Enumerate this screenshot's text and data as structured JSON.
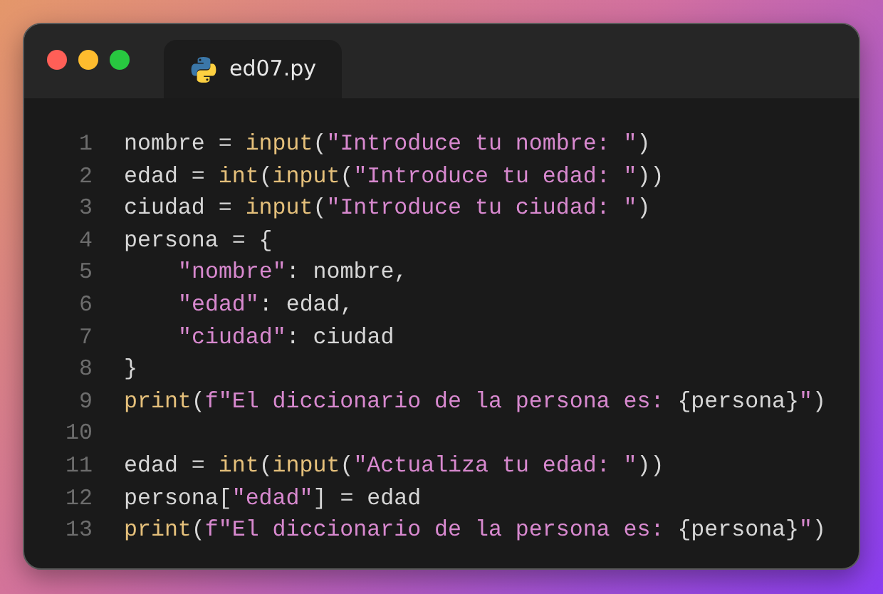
{
  "window": {
    "controls": [
      {
        "color": "#ff5f57"
      },
      {
        "color": "#febc2e"
      },
      {
        "color": "#28c840"
      }
    ]
  },
  "tabs": [
    {
      "label": "ed07.py",
      "selected": true
    }
  ],
  "code": [
    {
      "number": "1",
      "tokens": [
        {
          "kind": "plain",
          "text": "nombre = "
        },
        {
          "kind": "func",
          "text": "input"
        },
        {
          "kind": "plain",
          "text": "("
        },
        {
          "kind": "str",
          "text": "\"Introduce tu nombre: \""
        },
        {
          "kind": "plain",
          "text": ")"
        }
      ]
    },
    {
      "number": "2",
      "tokens": [
        {
          "kind": "plain",
          "text": "edad = "
        },
        {
          "kind": "func",
          "text": "int"
        },
        {
          "kind": "plain",
          "text": "("
        },
        {
          "kind": "func",
          "text": "input"
        },
        {
          "kind": "plain",
          "text": "("
        },
        {
          "kind": "str",
          "text": "\"Introduce tu edad: \""
        },
        {
          "kind": "plain",
          "text": "))"
        }
      ]
    },
    {
      "number": "3",
      "tokens": [
        {
          "kind": "plain",
          "text": "ciudad = "
        },
        {
          "kind": "func",
          "text": "input"
        },
        {
          "kind": "plain",
          "text": "("
        },
        {
          "kind": "str",
          "text": "\"Introduce tu ciudad: \""
        },
        {
          "kind": "plain",
          "text": ")"
        }
      ]
    },
    {
      "number": "4",
      "tokens": [
        {
          "kind": "plain",
          "text": "persona = {"
        }
      ],
      "children": [
        {
          "number": "5",
          "tokens": [
            {
              "kind": "str",
              "text": "\"nombre\""
            },
            {
              "kind": "plain",
              "text": ": nombre,"
            }
          ]
        },
        {
          "number": "6",
          "tokens": [
            {
              "kind": "str",
              "text": "\"edad\""
            },
            {
              "kind": "plain",
              "text": ": edad,"
            }
          ]
        },
        {
          "number": "7",
          "tokens": [
            {
              "kind": "str",
              "text": "\"ciudad\""
            },
            {
              "kind": "plain",
              "text": ": ciudad"
            }
          ]
        }
      ]
    },
    {
      "number": "8",
      "tokens": [
        {
          "kind": "plain",
          "text": "}"
        }
      ]
    },
    {
      "number": "9",
      "tokens": [
        {
          "kind": "func",
          "text": "print"
        },
        {
          "kind": "plain",
          "text": "("
        },
        {
          "kind": "str",
          "text": "f\"El diccionario de la persona es: "
        },
        {
          "kind": "plain",
          "text": "{persona}"
        },
        {
          "kind": "str",
          "text": "\""
        },
        {
          "kind": "plain",
          "text": ")"
        }
      ]
    },
    {
      "number": "10"
    },
    {
      "number": "11",
      "tokens": [
        {
          "kind": "plain",
          "text": "edad = "
        },
        {
          "kind": "func",
          "text": "int"
        },
        {
          "kind": "plain",
          "text": "("
        },
        {
          "kind": "func",
          "text": "input"
        },
        {
          "kind": "plain",
          "text": "("
        },
        {
          "kind": "str",
          "text": "\"Actualiza tu edad: \""
        },
        {
          "kind": "plain",
          "text": "))"
        }
      ]
    },
    {
      "number": "12",
      "tokens": [
        {
          "kind": "plain",
          "text": "persona["
        },
        {
          "kind": "str",
          "text": "\"edad\""
        },
        {
          "kind": "plain",
          "text": "] = edad"
        }
      ]
    },
    {
      "number": "13",
      "tokens": [
        {
          "kind": "func",
          "text": "print"
        },
        {
          "kind": "plain",
          "text": "("
        },
        {
          "kind": "str",
          "text": "f\"El diccionario de la persona es: "
        },
        {
          "kind": "plain",
          "text": "{persona}"
        },
        {
          "kind": "str",
          "text": "\""
        },
        {
          "kind": "plain",
          "text": ")"
        }
      ]
    }
  ]
}
